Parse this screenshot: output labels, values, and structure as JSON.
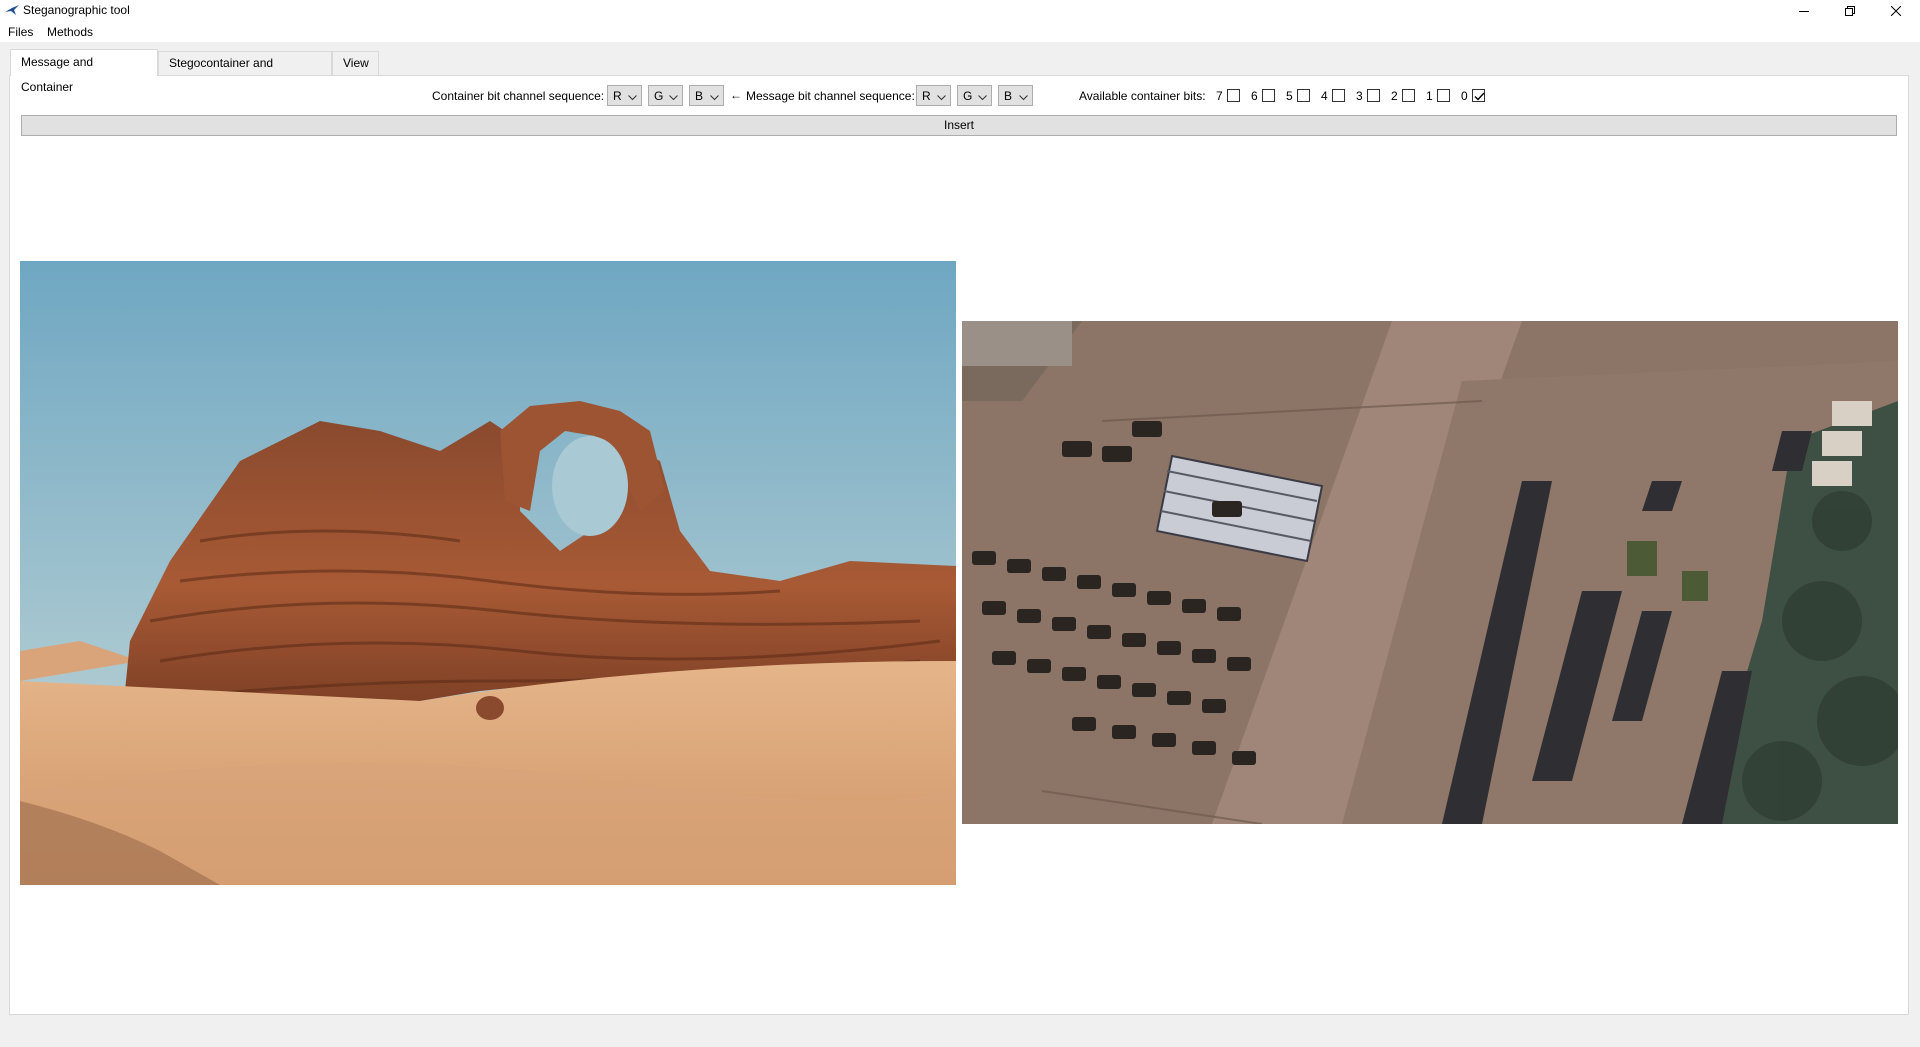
{
  "window": {
    "title": "Steganographic tool",
    "app_icon": "bird-app-icon",
    "controls": [
      "minimize-icon",
      "restore-icon",
      "close-icon"
    ]
  },
  "menu": {
    "files": "Files",
    "methods": "Methods"
  },
  "tabs": [
    {
      "label": "Message and Container",
      "active": true
    },
    {
      "label": "Stegocontainer and Statistics",
      "active": false
    },
    {
      "label": "View",
      "active": false
    }
  ],
  "controls": {
    "container_label": "Container bit channel sequence:",
    "container_channels": [
      "R",
      "G",
      "B"
    ],
    "arrow": "←",
    "message_label": "Message bit channel sequence:",
    "message_channels": [
      "R",
      "G",
      "B"
    ],
    "bits_label": "Available container bits:",
    "bits": [
      {
        "label": "7",
        "checked": false
      },
      {
        "label": "6",
        "checked": false
      },
      {
        "label": "5",
        "checked": false
      },
      {
        "label": "4",
        "checked": false
      },
      {
        "label": "3",
        "checked": false
      },
      {
        "label": "2",
        "checked": false
      },
      {
        "label": "1",
        "checked": false
      },
      {
        "label": "0",
        "checked": true
      }
    ]
  },
  "insert_button": "Insert",
  "images": {
    "container": "desert-arch-photo",
    "message": "aerial-vehicle-yard-photo"
  },
  "colors": {
    "window_bg": "#f0f0f0",
    "panel_bg": "#ffffff",
    "button_bg": "#e1e1e1",
    "border": "#adadad"
  }
}
